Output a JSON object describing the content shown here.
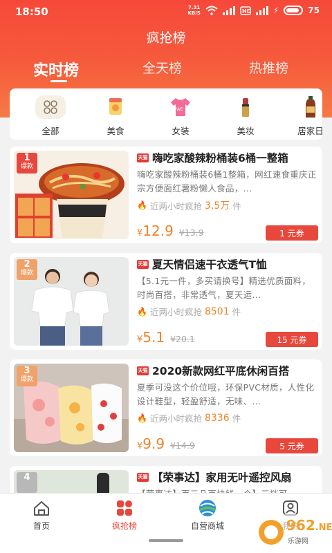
{
  "status_bar": {
    "time": "18:50",
    "net_speed_value": "7.31",
    "net_speed_unit": "KB/S",
    "battery": "75"
  },
  "header": {
    "title": "疯抢榜",
    "tabs": [
      {
        "label": "实时榜",
        "active": true
      },
      {
        "label": "全天榜",
        "active": false
      },
      {
        "label": "热推榜",
        "active": false
      }
    ]
  },
  "categories": [
    {
      "label": "全部",
      "icon": "grid-icon"
    },
    {
      "label": "美食",
      "icon": "food-icon"
    },
    {
      "label": "女装",
      "icon": "clothing-icon"
    },
    {
      "label": "美妆",
      "icon": "lipstick-icon"
    },
    {
      "label": "居家日",
      "icon": "bottle-icon"
    }
  ],
  "products": [
    {
      "rank": "1",
      "rank_tag": "爆款",
      "badge": "天猫",
      "name": "嗨吃家酸辣粉桶装6桶一整箱",
      "desc": "嗨吃家酸辣粉桶装6桶1整箱，网红速食重庆正宗方便面红薯粉懒人食品，...",
      "sold_prefix": "近两小时疯抢",
      "sold_count": "3.5万",
      "sold_unit": "件",
      "price_symbol": "¥",
      "price": "12.9",
      "original_price": "¥13.9",
      "coupon": "1 元券"
    },
    {
      "rank": "2",
      "rank_tag": "爆款",
      "badge": "天猫",
      "name": "夏天情侣速干衣透气T恤",
      "desc": "【5.1元一件，多买请换号】精选优质面料，时尚百搭，非常透气，夏天运...",
      "sold_prefix": "近两小时疯抢",
      "sold_count": "8501",
      "sold_unit": "件",
      "price_symbol": "¥",
      "price": "5.1",
      "original_price": "¥20.1",
      "coupon": "15 元券"
    },
    {
      "rank": "3",
      "rank_tag": "爆款",
      "badge": "天猫",
      "name": "2020新款网红平底休闲百搭",
      "desc": "夏季可没这个价位哦，环保PVC材质，人性化设计鞋型，轻盈舒适，无味、...",
      "sold_prefix": "近两小时疯抢",
      "sold_count": "8336",
      "sold_unit": "件",
      "price_symbol": "¥",
      "price": "9.9",
      "original_price": "¥14.9",
      "coupon": "5 元券"
    },
    {
      "rank": "4",
      "rank_tag": "",
      "badge": "天猫",
      "name": "【荣事达】家用无叶遥控风扇",
      "desc": "【荣事达】百元几百块钱一个】三档可"
    }
  ],
  "bottom_nav": [
    {
      "label": "首页",
      "icon": "home-icon",
      "active": false
    },
    {
      "label": "疯抢榜",
      "icon": "rank-grid-icon",
      "active": true
    },
    {
      "label": "自营商城",
      "icon": "globe-icon",
      "active": false
    },
    {
      "label": "我的",
      "icon": "user-icon",
      "active": false
    }
  ],
  "watermark": {
    "text": "962",
    "suffix": ".NET",
    "sub": "乐游网"
  },
  "colors": {
    "brand_red": "#e8473c",
    "price_orange": "#f0832a",
    "header_top": "#f6483a"
  }
}
